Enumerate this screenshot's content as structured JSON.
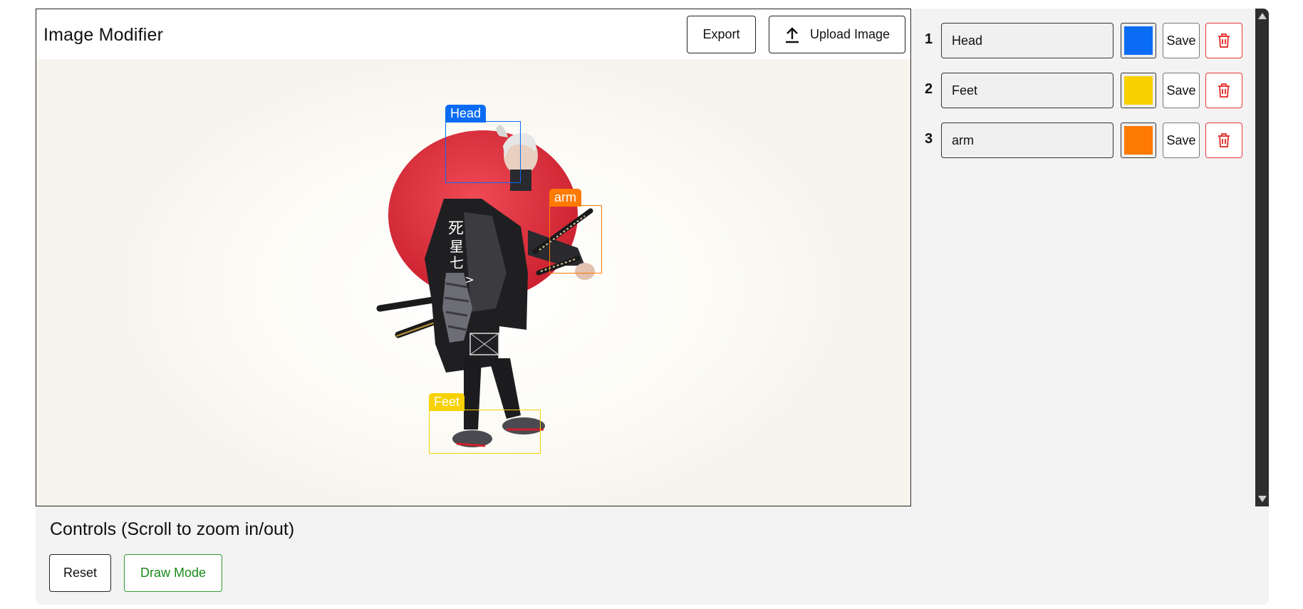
{
  "header": {
    "title": "Image Modifier",
    "export_label": "Export",
    "upload_label": "Upload Image",
    "upload_icon": "upload-icon"
  },
  "annotations": [
    {
      "label": "Head",
      "color": "#0a6cf5"
    },
    {
      "label": "Feet",
      "color": "#f7d100"
    },
    {
      "label": "arm",
      "color": "#ff7a00"
    }
  ],
  "sidebar": {
    "items": [
      {
        "num": "1",
        "value": "Head",
        "color": "#0a6cf5",
        "save_label": "Save",
        "delete_icon": "trash-icon"
      },
      {
        "num": "2",
        "value": "Feet",
        "color": "#f7d100",
        "save_label": "Save",
        "delete_icon": "trash-icon"
      },
      {
        "num": "3",
        "value": "arm",
        "color": "#ff7a00",
        "save_label": "Save",
        "delete_icon": "trash-icon"
      }
    ]
  },
  "controls": {
    "title": "Controls (Scroll to zoom in/out)",
    "reset_label": "Reset",
    "draw_mode_label": "Draw Mode"
  },
  "colors": {
    "delete_red": "#e53935",
    "draw_green": "#1a8a1a",
    "sun_red": "#d92f3c"
  }
}
